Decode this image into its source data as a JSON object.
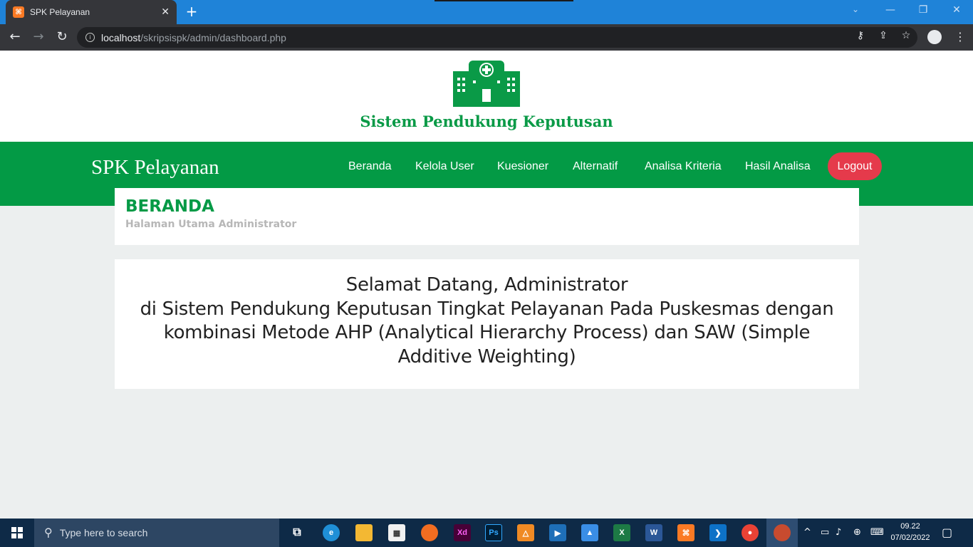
{
  "browser": {
    "tab_title": "SPK Pelayanan",
    "tab_close": "✕",
    "new_tab": "+",
    "url_host": "localhost",
    "url_path": "/skripsispk/admin/dashboard.php"
  },
  "header": {
    "brand_title": "Sistem Pendukung Keputusan"
  },
  "navbar": {
    "brand": "SPK Pelayanan",
    "links": [
      "Beranda",
      "Kelola User",
      "Kuesioner",
      "Alternatif",
      "Analisa Kriteria",
      "Hasil Analisa"
    ],
    "logout": "Logout"
  },
  "page": {
    "heading": "BERANDA",
    "subheading": "Halaman Utama Administrator",
    "welcome_lines": [
      "Selamat Datang, Administrator",
      "di Sistem Pendukung Keputusan Tingkat Pelayanan Pada Puskesmas dengan",
      "kombinasi Metode AHP (Analytical Hierarchy Process) dan SAW (Simple",
      "Additive Weighting)"
    ]
  },
  "taskbar": {
    "search_placeholder": "Type here to search",
    "time": "09.22",
    "date": "07/02/2022",
    "apps": [
      "task-view",
      "edge",
      "file-explorer",
      "store",
      "firefox",
      "adobe-xd",
      "photoshop",
      "network-app",
      "video-editor",
      "photos",
      "excel",
      "word",
      "xampp",
      "vscode",
      "chrome",
      "active-app"
    ]
  },
  "colors": {
    "brand_green": "#039a45",
    "logout_red": "#e53a4b",
    "tabbar_blue": "#1f83d8"
  }
}
